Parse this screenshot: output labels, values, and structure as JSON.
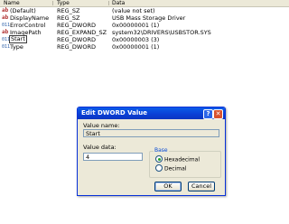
{
  "list": {
    "columns": [
      "Name",
      "Type",
      "Data"
    ],
    "rows": [
      {
        "icon": "ab",
        "name": "(Default)",
        "type": "REG_SZ",
        "data": "(value not set)"
      },
      {
        "icon": "ab",
        "name": "DisplayName",
        "type": "REG_SZ",
        "data": "USB Mass Storage Driver"
      },
      {
        "icon": "bin",
        "name": "ErrorControl",
        "type": "REG_DWORD",
        "data": "0x00000001 (1)"
      },
      {
        "icon": "ab",
        "name": "ImagePath",
        "type": "REG_EXPAND_SZ",
        "data": "system32\\DRIVERS\\USBSTOR.SYS"
      },
      {
        "icon": "bin",
        "name": "Start",
        "type": "REG_DWORD",
        "data": "0x00000003 (3)"
      },
      {
        "icon": "bin",
        "name": "Type",
        "type": "REG_DWORD",
        "data": "0x00000001 (1)"
      }
    ]
  },
  "dialog": {
    "title": "Edit DWORD Value",
    "help_glyph": "?",
    "close_glyph": "✕",
    "value_name_label": "Value name:",
    "value_name": "Start",
    "value_data_label": "Value data:",
    "value_data": "4",
    "base_label": "Base",
    "base_options": [
      "Hexadecimal",
      "Decimal"
    ],
    "base_selected": "Hexadecimal",
    "ok_label": "OK",
    "cancel_label": "Cancel"
  },
  "colors": {
    "titlebar": "#0a46dc",
    "close_button": "#d9522e",
    "dialog_face": "#ece9d8"
  }
}
